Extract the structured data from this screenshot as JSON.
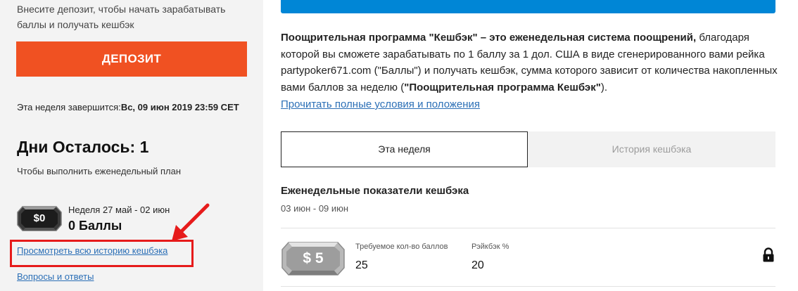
{
  "sidebar": {
    "intro": "Внесите депозит, чтобы начать зарабатывать баллы и получать кешбэк",
    "deposit_button": "ДЕПОЗИТ",
    "week_end_label": "Эта неделя завершится:",
    "week_end_value": "Вс, 09 июн 2019 23:59 CET",
    "days_left": "Дни Осталось: 1",
    "plan_text": "Чтобы выполнить еженедельный план",
    "chip_value": "$0",
    "week_range": "Неделя 27 май - 02 июн",
    "points": "0 Баллы",
    "history_link": "Просмотреть всю историю кешбэка",
    "faq_link": "Вопросы и ответы"
  },
  "main": {
    "desc_bold": "Поощрительная программа \"Кешбэк\" – это еженедельная система поощрений,",
    "desc_text": " благодаря которой вы сможете зарабатывать по 1 баллу за 1 дол. США в виде сгенерированного вами рейка partypoker671.com (\"Баллы\") и получать кешбэк, сумма которого зависит от количества накопленных вами баллов за неделю (",
    "desc_bold2": "\"Поощрительная программа Кешбэк\"",
    "desc_end": ").",
    "terms_link": "Прочитать полные условия и положения",
    "tabs": [
      {
        "label": "Эта неделя",
        "active": true
      },
      {
        "label": "История кешбэка",
        "active": false
      }
    ],
    "weekly_title": "Еженедельные показатели кешбэка",
    "weekly_dates": "03 июн - 09 июн",
    "tier": {
      "chip_value": "$ 5",
      "required_label": "Требуемое кол-во баллов",
      "required_value": "25",
      "rakeback_label": "Рэйкбэк %",
      "rakeback_value": "20",
      "icon": "lock-icon"
    }
  },
  "colors": {
    "accent_orange": "#f05122",
    "top_bar_blue": "#0086d6",
    "link_blue": "#2b6fb6",
    "highlight_red": "#e61b1b"
  }
}
